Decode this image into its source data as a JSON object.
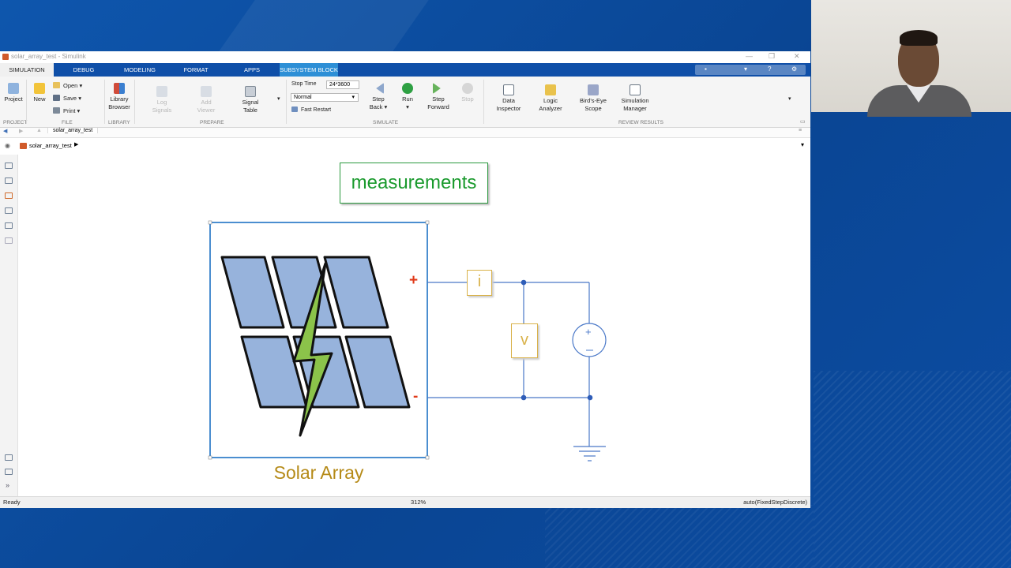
{
  "window": {
    "title": "solar_array_test - Simulink",
    "controls": [
      "—",
      "❐",
      "✕"
    ]
  },
  "tabs": [
    {
      "label": "SIMULATION",
      "active": true
    },
    {
      "label": "DEBUG"
    },
    {
      "label": "MODELING"
    },
    {
      "label": "FORMAT"
    },
    {
      "label": "APPS"
    },
    {
      "label": "SUBSYSTEM BLOCK",
      "highlight": true
    }
  ],
  "ribbon": {
    "project": {
      "label": "Project",
      "section": "PROJECT"
    },
    "file": {
      "new_label": "New",
      "open_label": "Open",
      "save_label": "Save",
      "print_label": "Print",
      "section": "FILE"
    },
    "library": {
      "label_line1": "Library",
      "label_line2": "Browser",
      "section": "LIBRARY"
    },
    "prepare": {
      "log_signals_1": "Log",
      "log_signals_2": "Signals",
      "add_viewer_1": "Add",
      "add_viewer_2": "Viewer",
      "signal_table_1": "Signal",
      "signal_table_2": "Table",
      "section": "PREPARE"
    },
    "simulate": {
      "stop_time_label": "Stop Time",
      "stop_time_value": "24*3600",
      "mode_value": "Normal",
      "fast_restart": "Fast Restart",
      "step_back_1": "Step",
      "step_back_2": "Back",
      "run": "Run",
      "step_forward_1": "Step",
      "step_forward_2": "Forward",
      "stop": "Stop",
      "section": "SIMULATE"
    },
    "review": {
      "data_inspector_1": "Data",
      "data_inspector_2": "Inspector",
      "logic_analyzer_1": "Logic",
      "logic_analyzer_2": "Analyzer",
      "birds_eye_1": "Bird's-Eye",
      "birds_eye_2": "Scope",
      "sim_manager_1": "Simulation",
      "sim_manager_2": "Manager",
      "section": "REVIEW RESULTS"
    }
  },
  "address_tab": "solar_array_test",
  "breadcrumb": "solar_array_test",
  "diagram": {
    "measurements_label": "measurements",
    "solar_label": "Solar Array",
    "plus": "+",
    "minus": "-",
    "current_sensor": "i",
    "voltage_sensor": "v"
  },
  "status": {
    "left": "Ready",
    "zoom": "312%",
    "solver": "auto(FixedStepDiscrete)"
  },
  "colors": {
    "tab_bar": "#0f4fa8",
    "subsystem_tab": "#2d8fd6",
    "measurements_green": "#1a9a2d",
    "solar_gold": "#b58a17",
    "wire_blue": "#4a78c8",
    "panel_blue": "#97b3dc"
  }
}
